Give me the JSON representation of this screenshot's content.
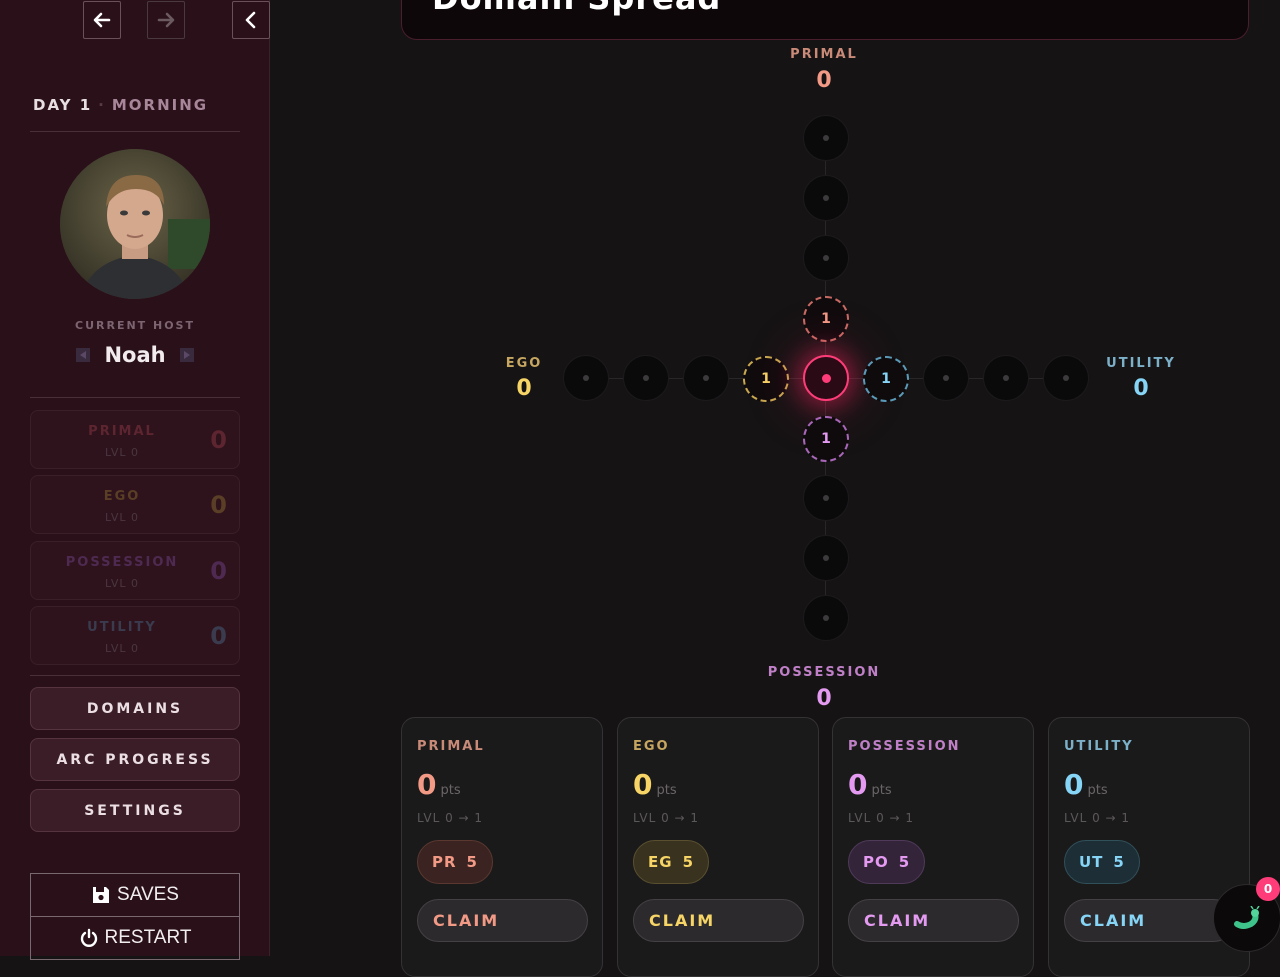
{
  "nav": {
    "back_icon": "arrow-left-icon",
    "forward_icon": "arrow-right-icon",
    "collapse_icon": "chevron-left-icon"
  },
  "time": {
    "day": "DAY 1",
    "separator": "·",
    "period": "MORNING"
  },
  "host": {
    "label": "CURRENT HOST",
    "name": "Noah"
  },
  "domains": [
    {
      "name": "PRIMAL",
      "level": "LVL 0",
      "value": "0",
      "color": "#5c2530"
    },
    {
      "name": "EGO",
      "level": "LVL 0",
      "value": "0",
      "color": "#5a3e26"
    },
    {
      "name": "POSSESSION",
      "level": "LVL 0",
      "value": "0",
      "color": "#4e2a52"
    },
    {
      "name": "UTILITY",
      "level": "LVL 0",
      "value": "0",
      "color": "#3a3b4e"
    }
  ],
  "menu": {
    "domains": "DOMAINS",
    "arc": "ARC PROGRESS",
    "settings": "SETTINGS"
  },
  "system": {
    "saves": "SAVES",
    "restart": "RESTART"
  },
  "main": {
    "title": "Domain Spread"
  },
  "axes": {
    "primal": {
      "label": "PRIMAL",
      "value": "0",
      "color": "#f39a86"
    },
    "ego": {
      "label": "EGO",
      "value": "0",
      "color": "#f6d466"
    },
    "possession": {
      "label": "POSSESSION",
      "value": "0",
      "color": "#e39af0"
    },
    "utility": {
      "label": "UTILITY",
      "value": "0",
      "color": "#86d4f6"
    }
  },
  "grid_markers": {
    "primal": "1",
    "ego": "1",
    "utility": "1",
    "possession": "1"
  },
  "cards": [
    {
      "name": "PRIMAL",
      "points": "0",
      "pts": "pts",
      "level": "LVL 0 → 1",
      "code": "PR",
      "cost": "5",
      "claim": "CLAIM"
    },
    {
      "name": "EGO",
      "points": "0",
      "pts": "pts",
      "level": "LVL 0 → 1",
      "code": "EG",
      "cost": "5",
      "claim": "CLAIM"
    },
    {
      "name": "POSSESSION",
      "points": "0",
      "pts": "pts",
      "level": "LVL 0 → 1",
      "code": "PO",
      "cost": "5",
      "claim": "CLAIM"
    },
    {
      "name": "UTILITY",
      "points": "0",
      "pts": "pts",
      "level": "LVL 0 → 1",
      "code": "UT",
      "cost": "5",
      "claim": "CLAIM"
    }
  ],
  "bug": {
    "count": "0",
    "icon": "bug-icon"
  }
}
